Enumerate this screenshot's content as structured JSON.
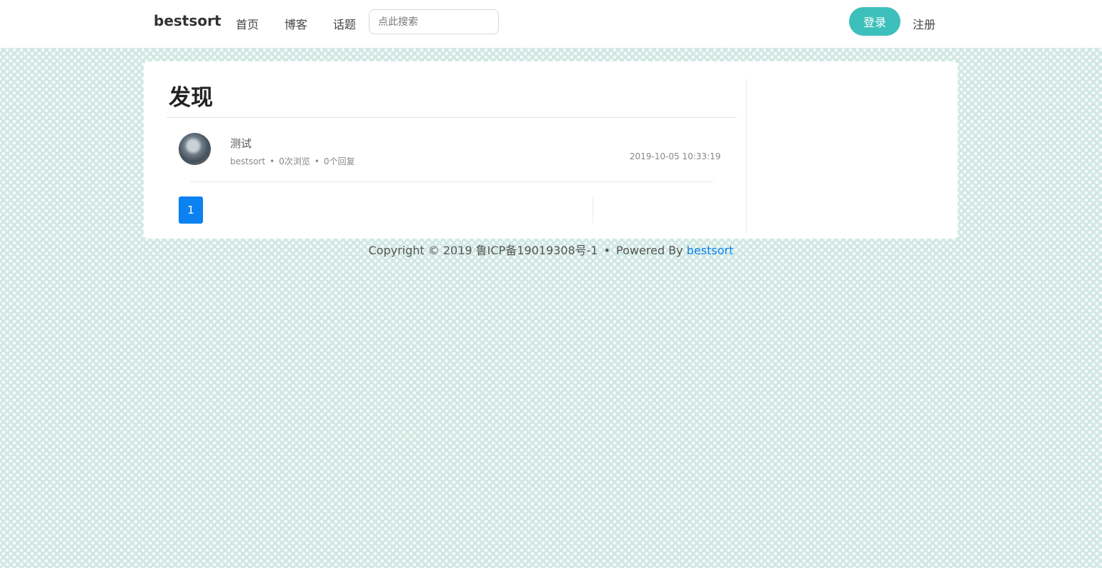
{
  "nav": {
    "brand": "bestsort",
    "links": [
      "首页",
      "博客",
      "话题"
    ],
    "search_placeholder": "点此搜索",
    "login": "登录",
    "register": "注册"
  },
  "main": {
    "title": "发现",
    "posts": [
      {
        "title": "测试",
        "author": "bestsort",
        "views": "0次浏览",
        "replies": "0个回复",
        "time": "2019-10-05 10:33:19"
      }
    ],
    "pagination": {
      "current": "1"
    }
  },
  "footer": {
    "copyright": "Copyright © 2019 鲁ICP备19019308号-1",
    "separator": "•",
    "powered_by": "Powered By",
    "powered_link": "bestsort"
  },
  "colors": {
    "accent": "#3dbfbb",
    "link": "#0b82f0",
    "background": "#cfe7e2"
  }
}
